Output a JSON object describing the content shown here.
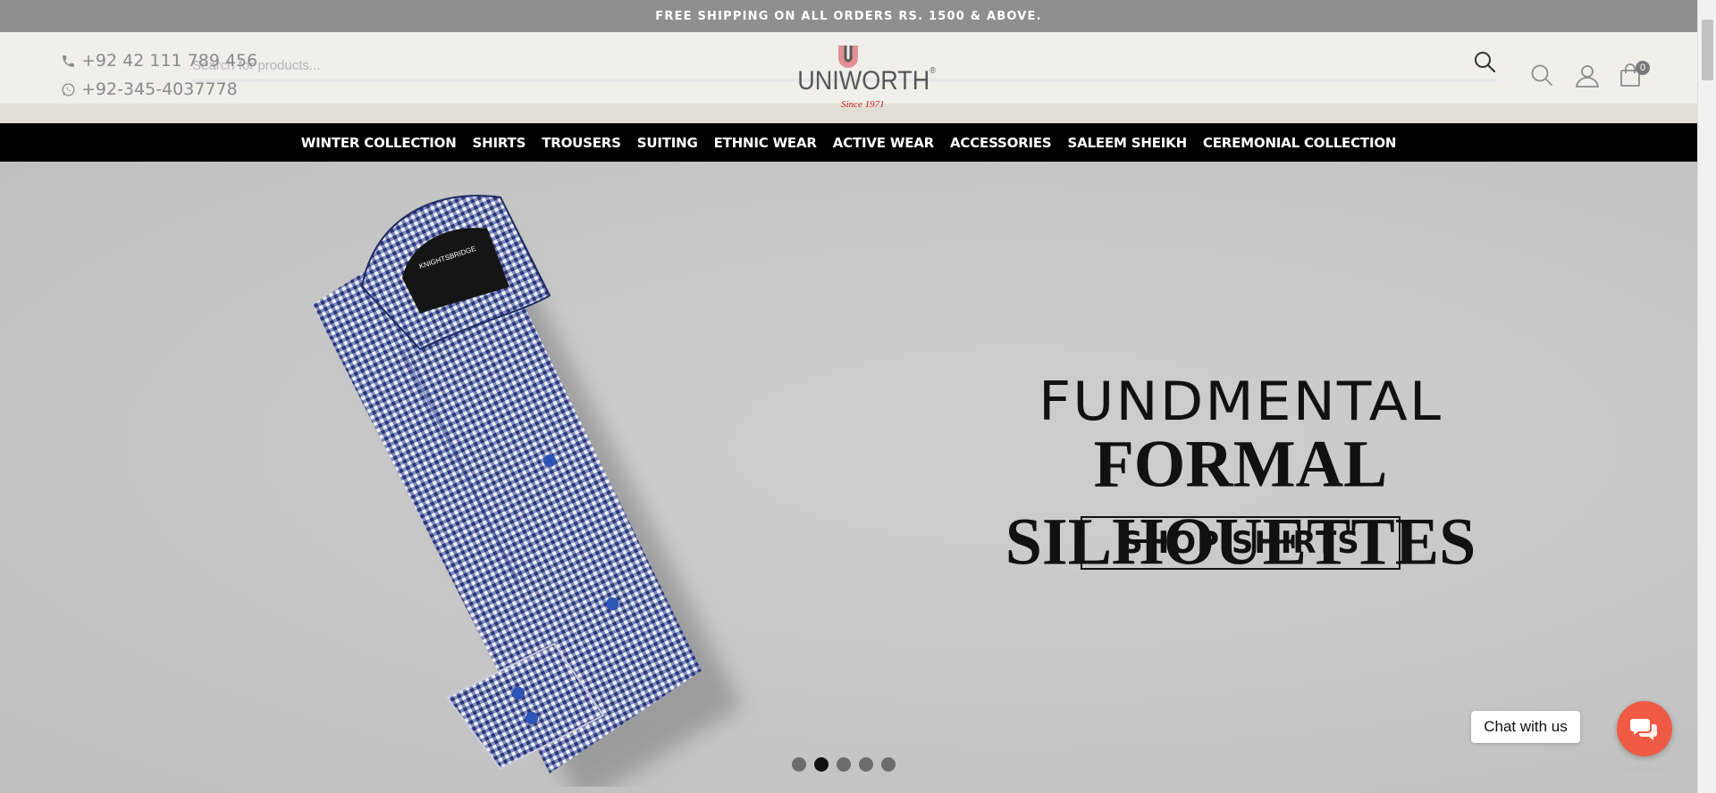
{
  "announcement": "FREE SHIPPING ON ALL ORDERS RS. 1500 & ABOVE.",
  "search": {
    "placeholder": "Search for products..."
  },
  "contact": {
    "phone": "+92 42 111 789 456",
    "whatsapp": "+92-345-4037778"
  },
  "logo": {
    "brand": "UNIWORTH",
    "registered": "®",
    "tagline": "Since 1971"
  },
  "header_icons": [
    "search-icon",
    "user-icon",
    "shopping-bag-icon"
  ],
  "cart": {
    "count": "0"
  },
  "nav": {
    "items": [
      "WINTER COLLECTION",
      "SHIRTS",
      "TROUSERS",
      "SUITING",
      "ETHNIC WEAR",
      "ACTIVE WEAR",
      "ACCESSORIES",
      "SALEEM SHEIKH",
      "CEREMONIAL COLLECTION"
    ]
  },
  "hero": {
    "line1": "FUNDMENTAL",
    "line2": "FORMAL SILHOUETTES",
    "cta": "SHOP SHIRTS",
    "slides_total": 5,
    "active_slide": 2
  },
  "chat": {
    "label": "Chat with us",
    "provider": "GetButton"
  },
  "colors": {
    "topbar": "#8f8f8f",
    "header_bg": "#f1efea",
    "nav_bg": "#000000",
    "hero_bg": "#c9c9c9",
    "chat_button": "#f05a44",
    "logo_red": "#c21f2c"
  }
}
